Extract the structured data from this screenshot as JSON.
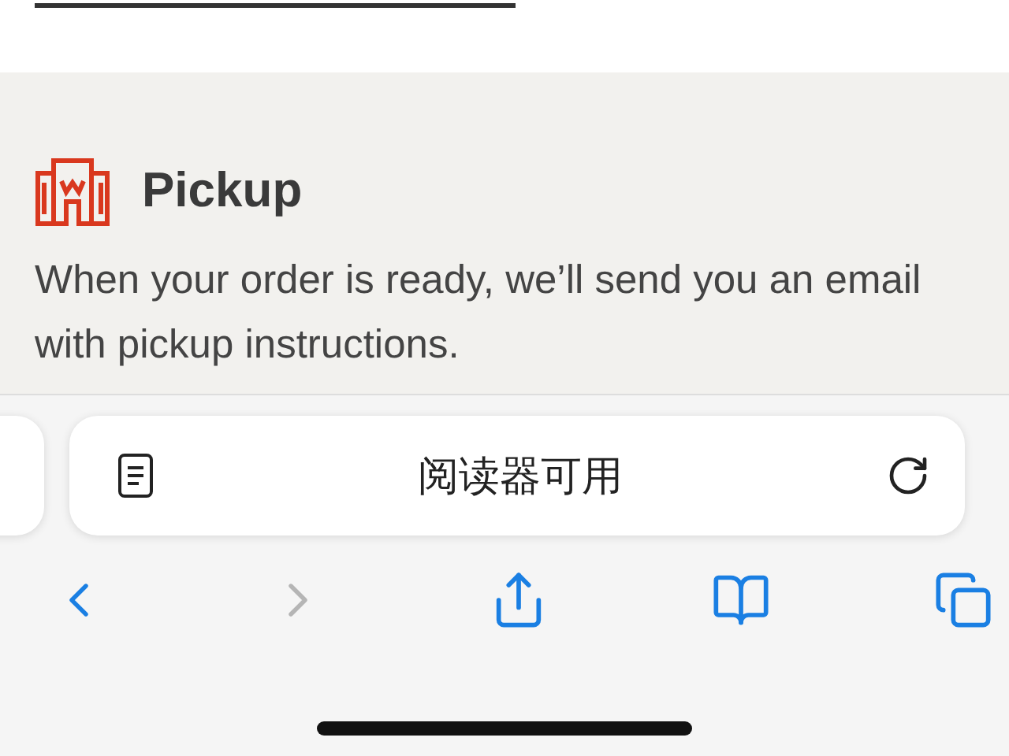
{
  "pickup": {
    "title": "Pickup",
    "description": "When your order is ready, we’ll send you an email with pickup instructions."
  },
  "address_bar": {
    "label": "阅读器可用"
  },
  "toolbar": [
    {
      "kind": "back",
      "disabled": false
    },
    {
      "kind": "forward",
      "disabled": true
    },
    {
      "kind": "share",
      "disabled": false
    },
    {
      "kind": "bookmarks",
      "disabled": false
    },
    {
      "kind": "tabs",
      "disabled": false
    }
  ]
}
